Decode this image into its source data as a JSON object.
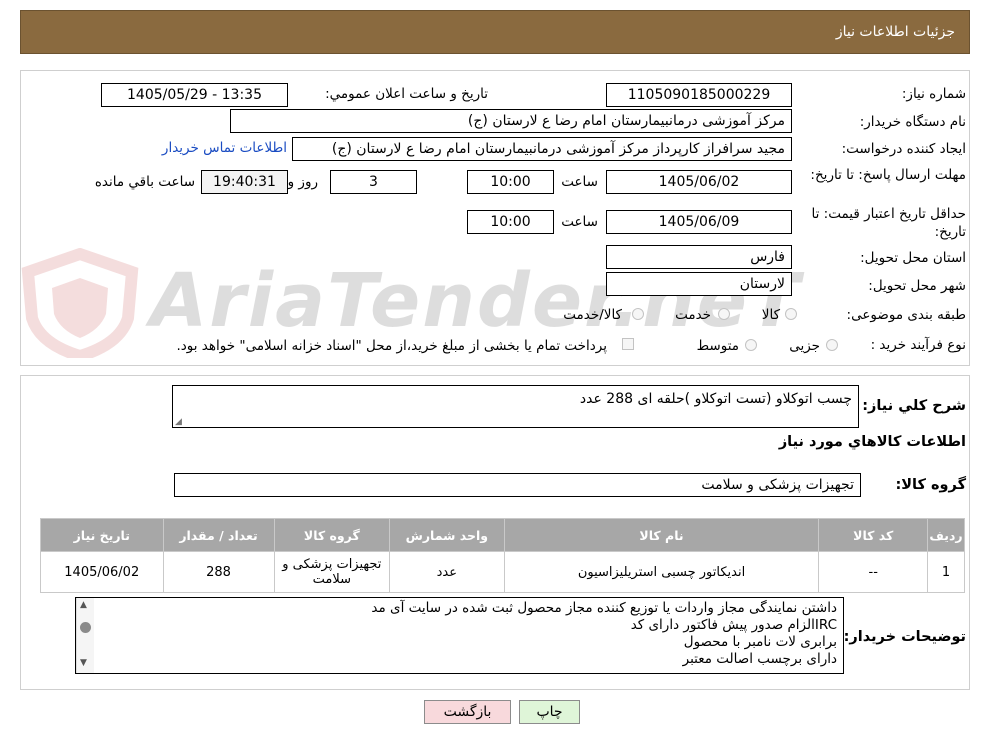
{
  "header": {
    "title": "جزئیات اطلاعات نیاز"
  },
  "form": {
    "need_number_label": "شماره نیاز:",
    "need_number": "1105090185000229",
    "announce_label": "تاریخ و ساعت اعلان عمومي:",
    "announce_value": "1405/05/29 - 13:35",
    "buyer_org_label": "نام دستگاه خریدار:",
    "buyer_org": "مرکز آموزشی درمانبیمارستان امام رضا  ع  لارستان (ج)",
    "creator_label": "ایجاد کننده درخواست:",
    "creator": "مجید سرافراز کارپرداز  مرکز آموزشی درمانبیمارستان امام رضا  ع  لارستان (ج)",
    "contact_link": "اطلاعات تماس خریدار",
    "deadline_label": "مهلت ارسال پاسخ: تا تاریخ:",
    "deadline_date": "1405/06/02",
    "time_label": "ساعت",
    "deadline_time": "10:00",
    "days": "3",
    "days_label": "روز و",
    "remaining_time": "19:40:31",
    "remaining_label": "ساعت باقي مانده",
    "validity_label": "حداقل تاریخ اعتبار قیمت: تا تاریخ:",
    "validity_date": "1405/06/09",
    "validity_time_label": "ساعت",
    "validity_time": "10:00",
    "province_label": "استان محل تحویل:",
    "province": "فارس",
    "city_label": "شهر محل تحویل:",
    "city": "لارستان",
    "category_label": "طبقه بندی موضوعی:",
    "category_options": [
      "کالا",
      "خدمت",
      "کالا/خدمت"
    ],
    "process_label": "نوع فرآیند خرید :",
    "process_options": [
      "جزیی",
      "متوسط"
    ],
    "payment_note": "پرداخت تمام یا بخشی از مبلغ خرید،از محل \"اسناد خزانه اسلامی\" خواهد بود."
  },
  "details": {
    "summary_label": "شرح کلي نياز:",
    "summary": "چسب اتوکلاو (تست اتوکلاو )حلقه ای 288 عدد",
    "goods_info_title": "اطلاعات کالاهاي مورد نياز",
    "goods_group_label": "گروه کالا:",
    "goods_group": "تجهیزات پزشکی و سلامت"
  },
  "table": {
    "headers": [
      "رديف",
      "کد کالا",
      "نام کالا",
      "واحد شمارش",
      "گروه کالا",
      "تعداد / مقدار",
      "تاريخ نياز"
    ],
    "rows": [
      [
        "1",
        "--",
        "اندیکاتور چسبی استریلیزاسیون",
        "عدد",
        "تجهیزات پزشکی و سلامت",
        "288",
        "1405/06/02"
      ]
    ]
  },
  "buyer_notes": {
    "label": "توضیحات خریدار:",
    "lines": [
      "داشتن نمایندگی مجاز واردات یا توزیع کننده مجاز محصول ثبت شده در سایت آی مد",
      "IRCالزام صدور پیش فاکتور دارای کد",
      "برابری لات نامبر با محصول",
      "دارای برچسب اصالت معتبر"
    ]
  },
  "buttons": {
    "print": "چاپ",
    "back": "بازگشت"
  },
  "watermark": {
    "text": "AriaTender.neT"
  },
  "colors": {
    "header_bg": "#8a6a3f",
    "link": "#1a4cc2",
    "back_button": "#f8d9dc",
    "print_button": "#dff5d8"
  }
}
